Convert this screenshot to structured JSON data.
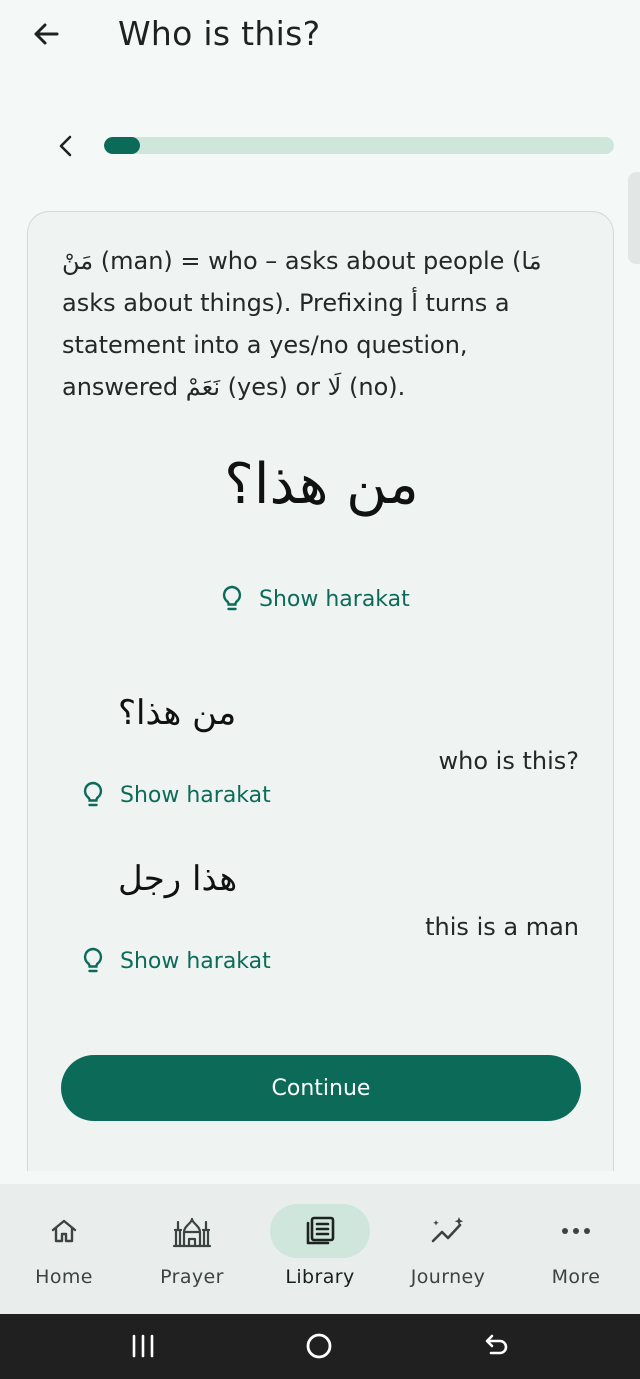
{
  "header": {
    "title": "Who is this?"
  },
  "progress": {
    "fraction": 0.07
  },
  "lesson": {
    "explanation": [
      {
        "t": "ar",
        "v": "مَنْ"
      },
      {
        "t": "en",
        "v": " (man) = who – asks about people ("
      },
      {
        "t": "ar",
        "v": "مَا"
      },
      {
        "t": "en",
        "v": " asks about things). Prefixing "
      },
      {
        "t": "ar",
        "v": "أ"
      },
      {
        "t": "en",
        "v": " turns a statement into a yes/no question, answered "
      },
      {
        "t": "ar",
        "v": "نَعَمْ"
      },
      {
        "t": "en",
        "v": " (yes) or "
      },
      {
        "t": "ar",
        "v": "لَا"
      },
      {
        "t": "en",
        "v": " (no)."
      }
    ],
    "main_arabic": "من هذا؟",
    "show_harakat": "Show harakat",
    "examples": [
      {
        "arabic": "من هذا؟",
        "english": "who is this?",
        "harakat": "Show harakat"
      },
      {
        "arabic": "هذا رجل",
        "english": "this is a man",
        "harakat": "Show harakat"
      }
    ],
    "continue_label": "Continue"
  },
  "nav": {
    "items": [
      {
        "label": "Home",
        "icon": "home-icon",
        "active": false
      },
      {
        "label": "Prayer",
        "icon": "mosque-icon",
        "active": false
      },
      {
        "label": "Library",
        "icon": "library-icon",
        "active": true
      },
      {
        "label": "Journey",
        "icon": "journey-icon",
        "active": false
      },
      {
        "label": "More",
        "icon": "more-icon",
        "active": false
      }
    ]
  },
  "colors": {
    "accent": "#0c6b58",
    "track": "#cfe6dd",
    "background": "#f4f9f7"
  }
}
